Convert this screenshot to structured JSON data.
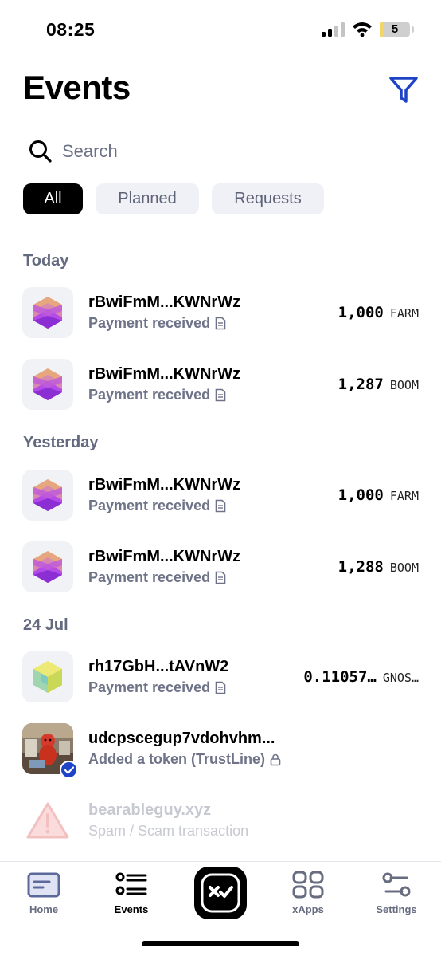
{
  "status_bar": {
    "time": "08:25",
    "battery_level": "5",
    "battery_fraction": 0.05
  },
  "header": {
    "title": "Events",
    "filter_icon": "filter-funnel-icon",
    "accent_color": "#1f43c7"
  },
  "search": {
    "placeholder": "Search"
  },
  "tabs": [
    {
      "label": "All",
      "active": true
    },
    {
      "label": "Planned",
      "active": false
    },
    {
      "label": "Requests",
      "active": false
    }
  ],
  "sections": [
    {
      "header": "Today",
      "events": [
        {
          "title": "rBwiFmM...KWNrWz",
          "subtitle": "Payment received",
          "amount": "1,000",
          "currency": "FARM",
          "icon": "token-hexagon-purple-icon"
        },
        {
          "title": "rBwiFmM...KWNrWz",
          "subtitle": "Payment received",
          "amount": "1,287",
          "currency": "BOOM",
          "icon": "token-hexagon-purple-icon"
        }
      ]
    },
    {
      "header": "Yesterday",
      "events": [
        {
          "title": "rBwiFmM...KWNrWz",
          "subtitle": "Payment received",
          "amount": "1,000",
          "currency": "FARM",
          "icon": "token-hexagon-purple-icon"
        },
        {
          "title": "rBwiFmM...KWNrWz",
          "subtitle": "Payment received",
          "amount": "1,288",
          "currency": "BOOM",
          "icon": "token-hexagon-purple-icon"
        }
      ]
    },
    {
      "header": "24 Jul",
      "events": [
        {
          "title": "rh17GbH...tAVnW2",
          "subtitle": "Payment received",
          "amount": "0.11057…",
          "currency": "GNOS…",
          "icon": "token-hexagon-yellow-icon"
        },
        {
          "title": "udcpscegup7vdohvhm...",
          "subtitle": "Added a token (TrustLine)",
          "icon": "user-avatar-photo"
        },
        {
          "title": "bearableguy.xyz",
          "subtitle": "Spam / Scam transaction",
          "icon": "warning-triangle-icon"
        }
      ]
    }
  ],
  "tab_bar": {
    "items": [
      {
        "label": "Home",
        "icon": "home-card-icon"
      },
      {
        "label": "Events",
        "icon": "list-icon",
        "active": true
      },
      {
        "label": "",
        "icon": "xaman-logo-icon"
      },
      {
        "label": "xApps",
        "icon": "grid-icon"
      },
      {
        "label": "Settings",
        "icon": "sliders-icon"
      }
    ]
  }
}
